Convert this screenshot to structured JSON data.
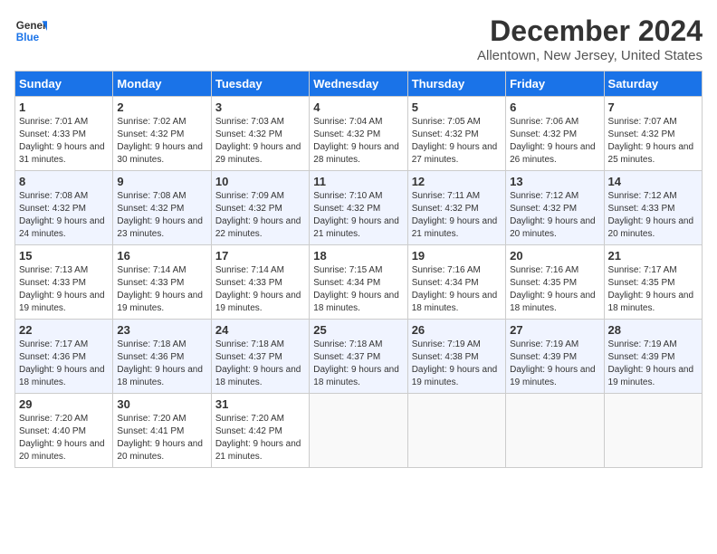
{
  "header": {
    "logo_general": "General",
    "logo_blue": "Blue",
    "month_title": "December 2024",
    "location": "Allentown, New Jersey, United States"
  },
  "weekdays": [
    "Sunday",
    "Monday",
    "Tuesday",
    "Wednesday",
    "Thursday",
    "Friday",
    "Saturday"
  ],
  "weeks": [
    [
      {
        "day": "1",
        "sunrise": "7:01 AM",
        "sunset": "4:33 PM",
        "daylight": "9 hours and 31 minutes."
      },
      {
        "day": "2",
        "sunrise": "7:02 AM",
        "sunset": "4:32 PM",
        "daylight": "9 hours and 30 minutes."
      },
      {
        "day": "3",
        "sunrise": "7:03 AM",
        "sunset": "4:32 PM",
        "daylight": "9 hours and 29 minutes."
      },
      {
        "day": "4",
        "sunrise": "7:04 AM",
        "sunset": "4:32 PM",
        "daylight": "9 hours and 28 minutes."
      },
      {
        "day": "5",
        "sunrise": "7:05 AM",
        "sunset": "4:32 PM",
        "daylight": "9 hours and 27 minutes."
      },
      {
        "day": "6",
        "sunrise": "7:06 AM",
        "sunset": "4:32 PM",
        "daylight": "9 hours and 26 minutes."
      },
      {
        "day": "7",
        "sunrise": "7:07 AM",
        "sunset": "4:32 PM",
        "daylight": "9 hours and 25 minutes."
      }
    ],
    [
      {
        "day": "8",
        "sunrise": "7:08 AM",
        "sunset": "4:32 PM",
        "daylight": "9 hours and 24 minutes."
      },
      {
        "day": "9",
        "sunrise": "7:08 AM",
        "sunset": "4:32 PM",
        "daylight": "9 hours and 23 minutes."
      },
      {
        "day": "10",
        "sunrise": "7:09 AM",
        "sunset": "4:32 PM",
        "daylight": "9 hours and 22 minutes."
      },
      {
        "day": "11",
        "sunrise": "7:10 AM",
        "sunset": "4:32 PM",
        "daylight": "9 hours and 21 minutes."
      },
      {
        "day": "12",
        "sunrise": "7:11 AM",
        "sunset": "4:32 PM",
        "daylight": "9 hours and 21 minutes."
      },
      {
        "day": "13",
        "sunrise": "7:12 AM",
        "sunset": "4:32 PM",
        "daylight": "9 hours and 20 minutes."
      },
      {
        "day": "14",
        "sunrise": "7:12 AM",
        "sunset": "4:33 PM",
        "daylight": "9 hours and 20 minutes."
      }
    ],
    [
      {
        "day": "15",
        "sunrise": "7:13 AM",
        "sunset": "4:33 PM",
        "daylight": "9 hours and 19 minutes."
      },
      {
        "day": "16",
        "sunrise": "7:14 AM",
        "sunset": "4:33 PM",
        "daylight": "9 hours and 19 minutes."
      },
      {
        "day": "17",
        "sunrise": "7:14 AM",
        "sunset": "4:33 PM",
        "daylight": "9 hours and 19 minutes."
      },
      {
        "day": "18",
        "sunrise": "7:15 AM",
        "sunset": "4:34 PM",
        "daylight": "9 hours and 18 minutes."
      },
      {
        "day": "19",
        "sunrise": "7:16 AM",
        "sunset": "4:34 PM",
        "daylight": "9 hours and 18 minutes."
      },
      {
        "day": "20",
        "sunrise": "7:16 AM",
        "sunset": "4:35 PM",
        "daylight": "9 hours and 18 minutes."
      },
      {
        "day": "21",
        "sunrise": "7:17 AM",
        "sunset": "4:35 PM",
        "daylight": "9 hours and 18 minutes."
      }
    ],
    [
      {
        "day": "22",
        "sunrise": "7:17 AM",
        "sunset": "4:36 PM",
        "daylight": "9 hours and 18 minutes."
      },
      {
        "day": "23",
        "sunrise": "7:18 AM",
        "sunset": "4:36 PM",
        "daylight": "9 hours and 18 minutes."
      },
      {
        "day": "24",
        "sunrise": "7:18 AM",
        "sunset": "4:37 PM",
        "daylight": "9 hours and 18 minutes."
      },
      {
        "day": "25",
        "sunrise": "7:18 AM",
        "sunset": "4:37 PM",
        "daylight": "9 hours and 18 minutes."
      },
      {
        "day": "26",
        "sunrise": "7:19 AM",
        "sunset": "4:38 PM",
        "daylight": "9 hours and 19 minutes."
      },
      {
        "day": "27",
        "sunrise": "7:19 AM",
        "sunset": "4:39 PM",
        "daylight": "9 hours and 19 minutes."
      },
      {
        "day": "28",
        "sunrise": "7:19 AM",
        "sunset": "4:39 PM",
        "daylight": "9 hours and 19 minutes."
      }
    ],
    [
      {
        "day": "29",
        "sunrise": "7:20 AM",
        "sunset": "4:40 PM",
        "daylight": "9 hours and 20 minutes."
      },
      {
        "day": "30",
        "sunrise": "7:20 AM",
        "sunset": "4:41 PM",
        "daylight": "9 hours and 20 minutes."
      },
      {
        "day": "31",
        "sunrise": "7:20 AM",
        "sunset": "4:42 PM",
        "daylight": "9 hours and 21 minutes."
      },
      null,
      null,
      null,
      null
    ]
  ],
  "labels": {
    "sunrise_prefix": "Sunrise: ",
    "sunset_prefix": "Sunset: ",
    "daylight_prefix": "Daylight: "
  }
}
